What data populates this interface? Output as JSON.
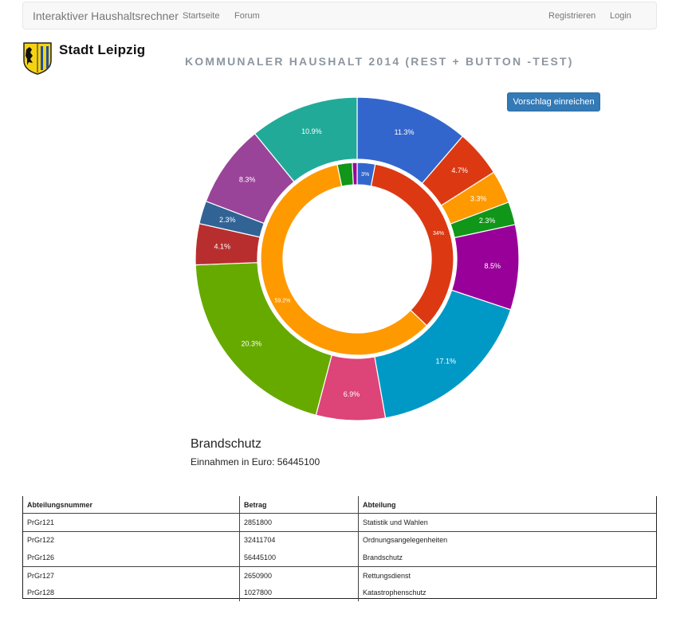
{
  "navbar": {
    "brand": "Interaktiver Haushaltsrechner",
    "links": [
      "Startseite",
      "Forum"
    ],
    "right_links": [
      "Registrieren",
      "Login"
    ]
  },
  "logo": {
    "text": "Stadt Leipzig"
  },
  "page": {
    "title": "KOMMUNALER HAUSHALT 2014 (REST + BUTTON -TEST)",
    "submit_label": "Vorschlag einreichen"
  },
  "chart_data": {
    "type": "pie",
    "outer": {
      "values": [
        11.3,
        4.7,
        3.3,
        2.3,
        8.5,
        17.1,
        6.9,
        20.3,
        4.1,
        2.3,
        8.3,
        10.9
      ],
      "labels": [
        "11.3%",
        "4.7%",
        "3.3%",
        "2.3%",
        "8.5%",
        "17.1%",
        "6.9%",
        "20.3%",
        "4.1%",
        "2.3%",
        "8.3%",
        "10.9%"
      ],
      "colors": [
        "#3366cc",
        "#dc3912",
        "#ff9900",
        "#109618",
        "#990099",
        "#0099c6",
        "#dd4477",
        "#66aa00",
        "#b82e2e",
        "#316395",
        "#994499",
        "#22aa99"
      ]
    },
    "inner": {
      "values": [
        3,
        34,
        59.2,
        2.5,
        0.8
      ],
      "labels": [
        "3%",
        "34%",
        "59.2%",
        "",
        ""
      ],
      "colors": [
        "#3366cc",
        "#dc3912",
        "#ff9900",
        "#109618",
        "#990099"
      ]
    }
  },
  "detail": {
    "name": "Brandschutz",
    "amount": "Einnahmen in Euro: 56445100"
  },
  "table": {
    "headers": [
      "Abteilungsnummer",
      "Betrag",
      "Abteilung"
    ],
    "rows": [
      [
        "PrGr121",
        "2851800",
        "Statistik und Wahlen"
      ],
      [
        "PrGr122",
        "32411704",
        "Ordnungsangelegenheiten"
      ],
      [
        "PrGr126",
        "56445100",
        "Brandschutz"
      ],
      [
        "PrGr127",
        "2650900",
        "Rettungsdienst"
      ],
      [
        "PrGr128",
        "1027800",
        "Katastrophenschutz"
      ]
    ]
  }
}
